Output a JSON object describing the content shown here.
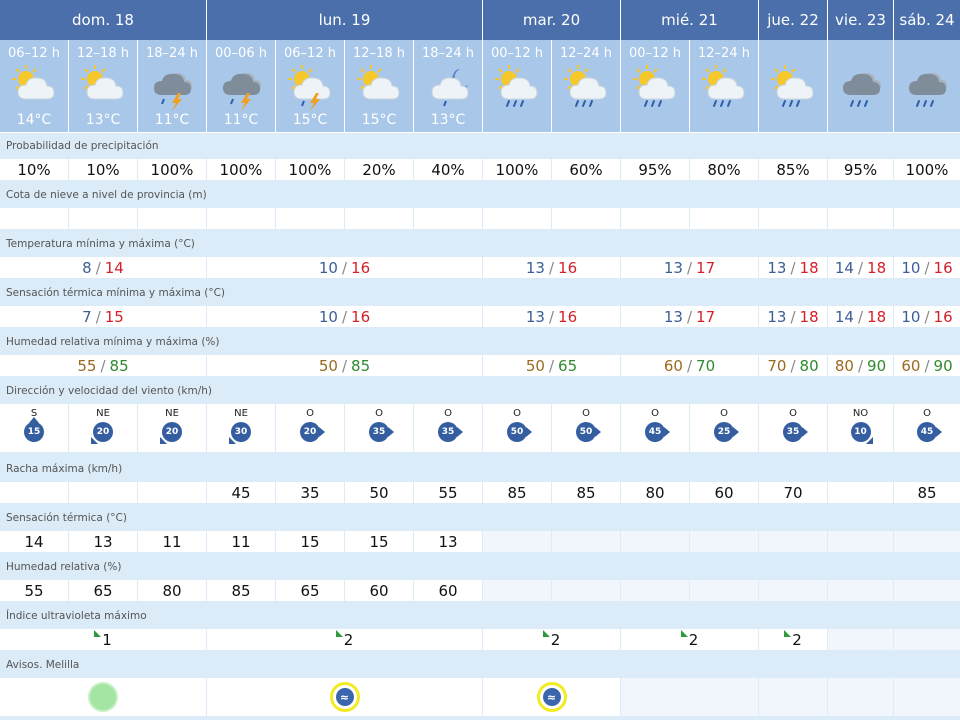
{
  "days": [
    {
      "label": "dom. 18"
    },
    {
      "label": "lun. 19"
    },
    {
      "label": "mar. 20"
    },
    {
      "label": "mié. 21"
    },
    {
      "label": "jue. 22"
    },
    {
      "label": "vie. 23"
    },
    {
      "label": "sáb. 24"
    }
  ],
  "periods": [
    {
      "label": "06–12 h",
      "temp": "14°C",
      "icon": "sun-cloud-icon"
    },
    {
      "label": "12–18 h",
      "temp": "13°C",
      "icon": "sun-cloud-icon"
    },
    {
      "label": "18–24 h",
      "temp": "11°C",
      "icon": "storm-rain-icon"
    },
    {
      "label": "00–06 h",
      "temp": "11°C",
      "icon": "storm-rain-icon"
    },
    {
      "label": "06–12 h",
      "temp": "15°C",
      "icon": "sun-storm-icon"
    },
    {
      "label": "12–18 h",
      "temp": "15°C",
      "icon": "sun-cloud-icon"
    },
    {
      "label": "18–24 h",
      "temp": "13°C",
      "icon": "moon-cloud-rain-icon"
    },
    {
      "label": "00–12 h",
      "temp": "",
      "icon": "sun-cloud-rain-icon"
    },
    {
      "label": "12–24 h",
      "temp": "",
      "icon": "sun-cloud-rain-icon"
    },
    {
      "label": "00–12 h",
      "temp": "",
      "icon": "sun-cloud-rain-icon"
    },
    {
      "label": "12–24 h",
      "temp": "",
      "icon": "sun-cloud-rain-icon"
    },
    {
      "label": "",
      "temp": "",
      "icon": "sun-cloud-rain-icon"
    },
    {
      "label": "",
      "temp": "",
      "icon": "cloud-rain-icon"
    },
    {
      "label": "",
      "temp": "",
      "icon": "cloud-rain-icon"
    }
  ],
  "sections": {
    "precip": "Probabilidad de precipitación",
    "snow": "Cota de nieve a nivel de provincia (m)",
    "temp": "Temperatura mínima y máxima (°C)",
    "feels": "Sensación térmica mínima y máxima (°C)",
    "humidity": "Humedad relativa mínima y máxima (%)",
    "wind": "Dirección y velocidad del viento (km/h)",
    "gust": "Racha máxima (km/h)",
    "feels_now": "Sensación térmica (°C)",
    "hum_now": "Humedad relativa (%)",
    "uv": "Índice ultravioleta máximo",
    "warnings": "Avisos. Melilla"
  },
  "precip": [
    "10%",
    "10%",
    "100%",
    "100%",
    "100%",
    "20%",
    "40%",
    "100%",
    "60%",
    "95%",
    "80%",
    "85%",
    "95%",
    "100%"
  ],
  "temp": [
    {
      "min": "8",
      "max": "14"
    },
    {
      "min": "10",
      "max": "16"
    },
    {
      "min": "13",
      "max": "16"
    },
    {
      "min": "13",
      "max": "17"
    },
    {
      "min": "13",
      "max": "18"
    },
    {
      "min": "14",
      "max": "18"
    },
    {
      "min": "10",
      "max": "16"
    }
  ],
  "feels": [
    {
      "min": "7",
      "max": "15"
    },
    {
      "min": "10",
      "max": "16"
    },
    {
      "min": "13",
      "max": "16"
    },
    {
      "min": "13",
      "max": "17"
    },
    {
      "min": "13",
      "max": "18"
    },
    {
      "min": "14",
      "max": "18"
    },
    {
      "min": "10",
      "max": "16"
    }
  ],
  "humidity": [
    {
      "min": "55",
      "max": "85"
    },
    {
      "min": "50",
      "max": "85"
    },
    {
      "min": "50",
      "max": "65"
    },
    {
      "min": "60",
      "max": "70"
    },
    {
      "min": "70",
      "max": "80"
    },
    {
      "min": "80",
      "max": "90"
    },
    {
      "min": "60",
      "max": "90"
    }
  ],
  "wind": [
    {
      "dir": "S",
      "speed": "15"
    },
    {
      "dir": "NE",
      "speed": "20"
    },
    {
      "dir": "NE",
      "speed": "20"
    },
    {
      "dir": "NE",
      "speed": "30"
    },
    {
      "dir": "O",
      "speed": "20"
    },
    {
      "dir": "O",
      "speed": "35"
    },
    {
      "dir": "O",
      "speed": "35"
    },
    {
      "dir": "O",
      "speed": "50"
    },
    {
      "dir": "O",
      "speed": "50"
    },
    {
      "dir": "O",
      "speed": "45"
    },
    {
      "dir": "O",
      "speed": "25"
    },
    {
      "dir": "O",
      "speed": "35"
    },
    {
      "dir": "NO",
      "speed": "10"
    },
    {
      "dir": "O",
      "speed": "45"
    }
  ],
  "gust": [
    "",
    "",
    "",
    "45",
    "35",
    "50",
    "55",
    "85",
    "85",
    "80",
    "60",
    "70",
    "",
    "85"
  ],
  "feels_now": [
    "14",
    "13",
    "11",
    "11",
    "15",
    "15",
    "13",
    "",
    "",
    "",
    "",
    "",
    "",
    ""
  ],
  "hum_now": [
    "55",
    "65",
    "80",
    "85",
    "65",
    "60",
    "60",
    "",
    "",
    "",
    "",
    "",
    "",
    ""
  ],
  "uv": [
    "1",
    "2",
    "2",
    "2",
    "2",
    "",
    ""
  ],
  "warnings": [
    "green",
    "yellow",
    "yellow",
    "",
    "",
    "",
    ""
  ],
  "colors": {
    "header": "#4a6fab",
    "period": "#a9c7e9",
    "section": "#dbebf7",
    "min": "#3c5e95",
    "max": "#d5202a"
  }
}
